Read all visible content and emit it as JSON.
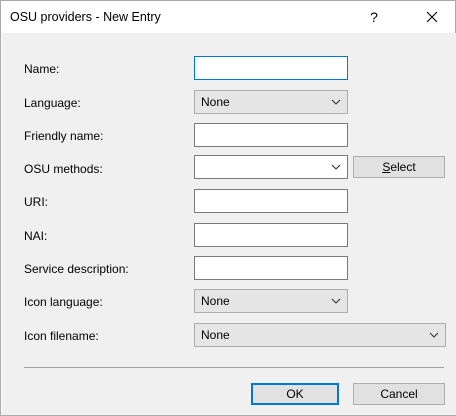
{
  "window": {
    "title": "OSU providers - New Entry",
    "help_glyph": "?",
    "close_icon": "close-icon"
  },
  "form": {
    "name_label": "Name:",
    "name_value": "",
    "language_label": "Language:",
    "language_value": "None",
    "friendly_name_label": "Friendly name:",
    "friendly_name_value": "",
    "osu_methods_label": "OSU methods:",
    "osu_methods_value": "",
    "select_button_mnemonic": "S",
    "select_button_rest": "elect",
    "uri_label": "URI:",
    "uri_value": "",
    "nai_label": "NAI:",
    "nai_value": "",
    "service_description_label": "Service description:",
    "service_description_value": "",
    "icon_language_label": "Icon language:",
    "icon_language_value": "None",
    "icon_filename_label": "Icon filename:",
    "icon_filename_value": "None"
  },
  "buttons": {
    "ok": "OK",
    "cancel": "Cancel"
  },
  "colors": {
    "focus_accent": "#0078d7",
    "dialog_background": "#f0f0f0"
  }
}
